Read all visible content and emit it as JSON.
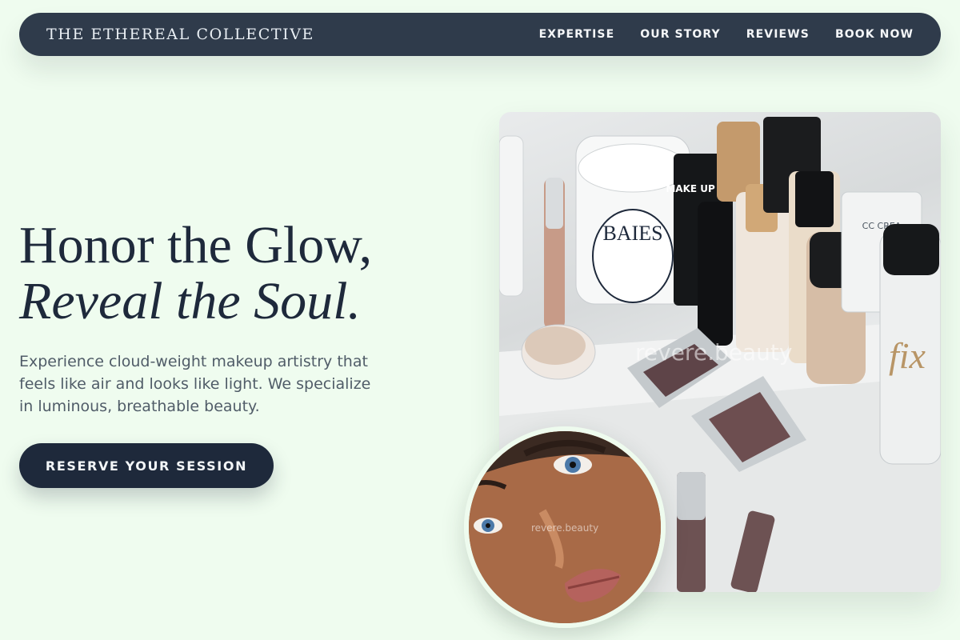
{
  "brand": "THE ETHEREAL COLLECTIVE",
  "nav": {
    "items": [
      "EXPERTISE",
      "OUR STORY",
      "REVIEWS",
      "BOOK NOW"
    ]
  },
  "hero": {
    "headline_line1": "Honor the Glow,",
    "headline_line2": "Reveal the Soul.",
    "lead": "Experience cloud-weight makeup artistry that feels like air and looks like light. We specialize in luminous, breathable beauty.",
    "cta_label": "RESERVE YOUR SESSION"
  },
  "images": {
    "main_watermark": "revere.beauty",
    "portrait_watermark": "revere.beauty",
    "product_labels": {
      "candle": "BAIES",
      "tube": "MAKE UP FOR",
      "cc": "CC CREA",
      "fix": "fix"
    }
  },
  "colors": {
    "background": "#effcef",
    "nav_bg": "#2f3b4b",
    "accent_dark": "#1e293b"
  }
}
